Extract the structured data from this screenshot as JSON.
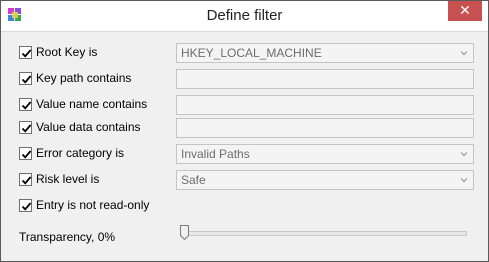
{
  "window": {
    "title": "Define filter",
    "close_glyph": "✕"
  },
  "icons": {
    "app": "registry-cube-icon",
    "close": "close-icon",
    "check": "checkmark-icon",
    "dropdown": "chevron-down-icon"
  },
  "colors": {
    "close_button": "#c75050",
    "field_bg": "#f4f4f4",
    "border": "#c4c4c4",
    "disabled_text": "#6d6d6d"
  },
  "filters": {
    "root_key": {
      "label": "Root Key is",
      "checked": true,
      "value": "HKEY_LOCAL_MACHINE"
    },
    "key_path": {
      "label": "Key path contains",
      "checked": true,
      "value": ""
    },
    "value_name": {
      "label": "Value name contains",
      "checked": true,
      "value": ""
    },
    "value_data": {
      "label": "Value data contains",
      "checked": true,
      "value": ""
    },
    "error_category": {
      "label": "Error category is",
      "checked": true,
      "value": "Invalid Paths"
    },
    "risk_level": {
      "label": "Risk level is",
      "checked": true,
      "value": "Safe"
    },
    "not_read_only": {
      "label": "Entry is not read-only",
      "checked": true
    }
  },
  "transparency": {
    "label": "Transparency, 0%",
    "value_percent": 0
  }
}
